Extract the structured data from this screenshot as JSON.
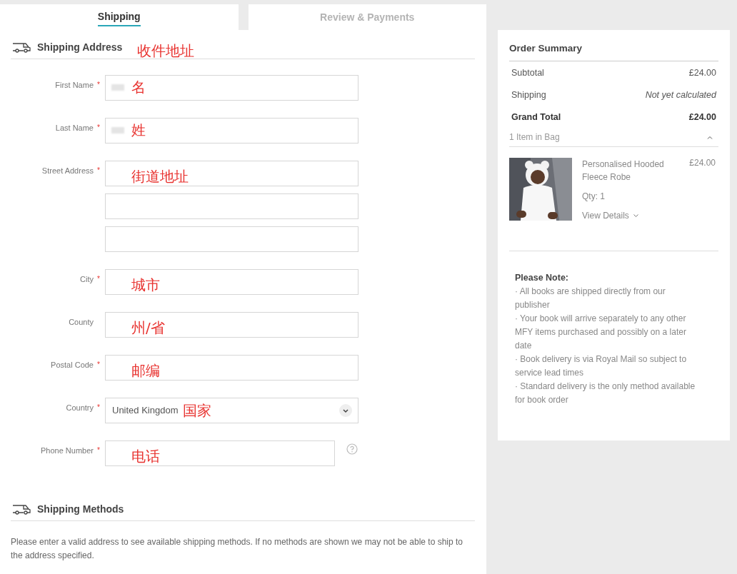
{
  "tabs": [
    {
      "label": "Shipping",
      "selected": true
    },
    {
      "label": "Review & Payments",
      "selected": false
    }
  ],
  "shipping_address": {
    "title": "Shipping Address",
    "annotation": "收件地址",
    "fields": [
      {
        "label": "First Name",
        "required_mark": "*",
        "kind": "text",
        "inputs": [
          {
            "annotation": "名",
            "redacted": true
          }
        ]
      },
      {
        "label": "Last Name",
        "required_mark": "*",
        "kind": "text",
        "inputs": [
          {
            "annotation": "姓",
            "redacted": true
          }
        ]
      },
      {
        "label": "Street Address",
        "required_mark": "*",
        "kind": "text",
        "inputs": [
          {
            "annotation": "街道地址",
            "redacted": false
          },
          {
            "redacted": false
          },
          {
            "redacted": false
          }
        ]
      },
      {
        "label": "City",
        "required_mark": "*",
        "kind": "text",
        "inputs": [
          {
            "annotation": "城市",
            "redacted": false
          }
        ]
      },
      {
        "label": "County",
        "kind": "text",
        "inputs": [
          {
            "annotation": "州/省",
            "redacted": false
          }
        ]
      },
      {
        "label": "Postal Code",
        "required_mark": "*",
        "kind": "text",
        "inputs": [
          {
            "annotation": "邮编",
            "redacted": false
          }
        ]
      },
      {
        "label": "Country",
        "required_mark": "*",
        "kind": "select",
        "inputs": [
          {
            "value": "United Kingdom",
            "annotation": "国家",
            "redacted": false
          }
        ]
      },
      {
        "label": "Phone Number",
        "required_mark": "*",
        "kind": "phone",
        "inputs": [
          {
            "annotation": "电话",
            "redacted": false
          }
        ]
      }
    ]
  },
  "shipping_methods": {
    "title": "Shipping Methods",
    "message": "Please enter a valid address to see available shipping methods. If no methods are shown we may not be able to ship to the address specified."
  },
  "order_summary": {
    "title": "Order Summary",
    "rows": [
      {
        "label": "Subtotal",
        "value": "£24.00",
        "kind": "normal"
      },
      {
        "label": "Shipping",
        "value": "Not yet calculated",
        "kind": "pending"
      },
      {
        "label": "Grand Total",
        "value": "£24.00",
        "kind": "total"
      }
    ],
    "bag": {
      "label": "1 Item in Bag",
      "expanded": true
    },
    "items": [
      {
        "name": "Personalised Hooded Fleece Robe",
        "price": "£24.00",
        "qty": "Qty: 1",
        "details": "View Details"
      }
    ],
    "note_title": "Please Note:",
    "notes": [
      "· All books are shipped directly from our publisher",
      "· Your book will arrive separately to any other MFY items purchased and possibly on a later date",
      "· Book delivery is via Royal Mail so subject to service lead times",
      "· Standard delivery is the only method available for book order"
    ]
  }
}
